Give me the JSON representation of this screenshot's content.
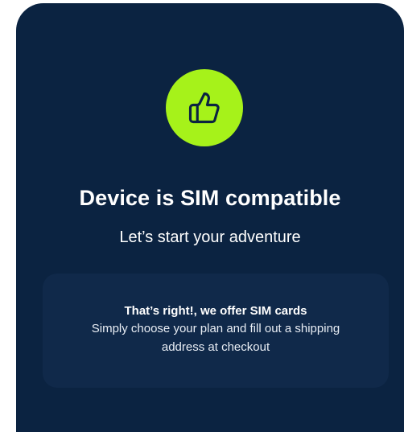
{
  "card": {
    "icon": "thumbs-up-icon",
    "title": "Device is SIM compatible",
    "subtitle": "Let’s start your adventure",
    "info": {
      "heading": "That’s right!, we offer SIM cards",
      "text": "Simply choose your plan and fill out a shipping address at checkout"
    }
  },
  "colors": {
    "card_background": "#0b2341",
    "info_background": "#10294a",
    "accent": "#a6f21a",
    "text": "#ffffff"
  }
}
